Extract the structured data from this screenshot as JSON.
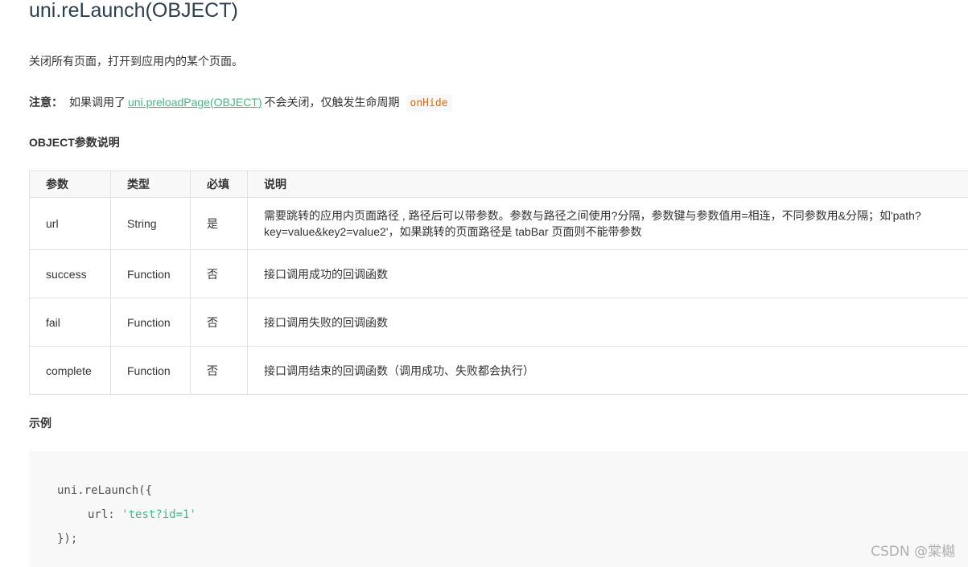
{
  "page": {
    "title": "uni.reLaunch(OBJECT)",
    "description": "关闭所有页面，打开到应用内的某个页面。",
    "note": {
      "label": "注意：",
      "text_before": "如果调用了",
      "link_text": "uni.preloadPage(OBJECT)",
      "text_after": "不会关闭，仅触发生命周期",
      "code": "onHide"
    },
    "params_heading": "OBJECT参数说明",
    "example_heading": "示例"
  },
  "table": {
    "headers": [
      "参数",
      "类型",
      "必填",
      "说明"
    ],
    "rows": [
      {
        "name": "url",
        "type": "String",
        "required": "是",
        "desc": "需要跳转的应用内页面路径 , 路径后可以带参数。参数与路径之间使用?分隔，参数键与参数值用=相连，不同参数用&分隔；如'path?key=value&key2=value2'，如果跳转的页面路径是 tabBar 页面则不能带参数"
      },
      {
        "name": "success",
        "type": "Function",
        "required": "否",
        "desc": "接口调用成功的回调函数"
      },
      {
        "name": "fail",
        "type": "Function",
        "required": "否",
        "desc": "接口调用失败的回调函数"
      },
      {
        "name": "complete",
        "type": "Function",
        "required": "否",
        "desc": "接口调用结束的回调函数（调用成功、失败都会执行）"
      }
    ]
  },
  "code": {
    "line1": "uni.reLaunch({",
    "line2_key": "url: ",
    "line2_value": "'test?id=1'",
    "line3": "});"
  },
  "watermark": "CSDN @棠樾",
  "colors": {
    "link": "#42b983",
    "inline_code": "#e96900",
    "code_bg": "#f8f8f8",
    "table_border": "#e2e2e2"
  }
}
